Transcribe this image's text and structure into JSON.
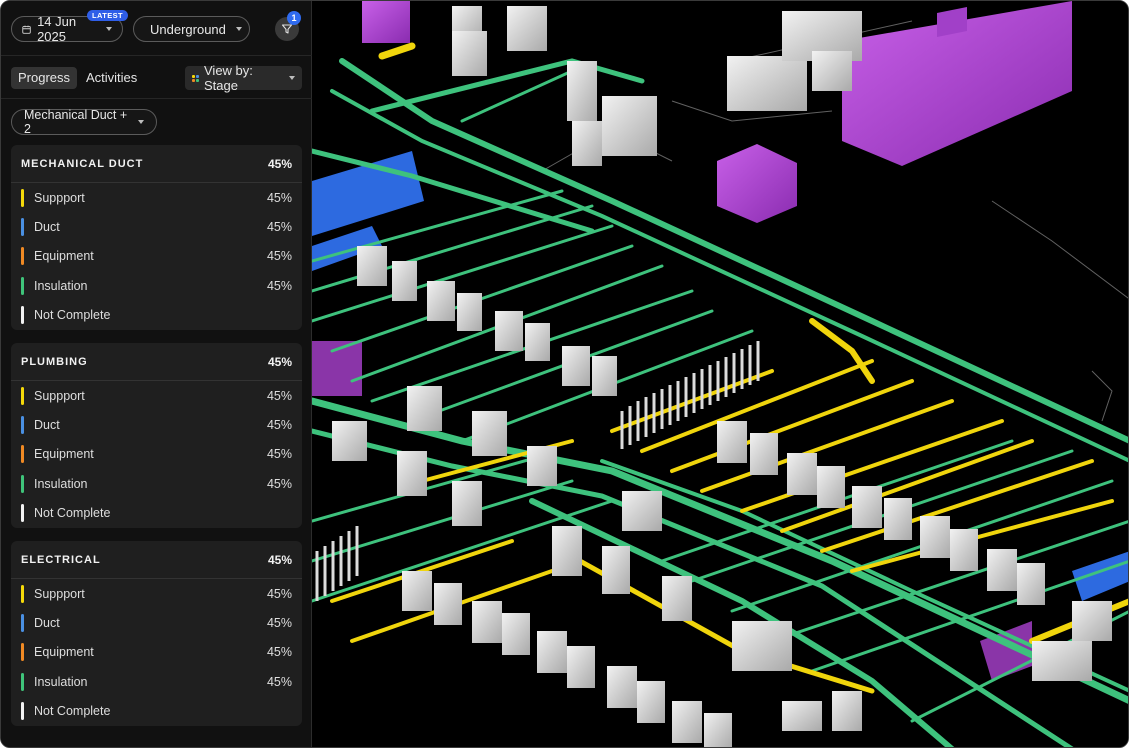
{
  "header": {
    "date_label": "14 Jun 2025",
    "latest_badge": "LATEST",
    "layer_label": "Underground",
    "filter_count": "1"
  },
  "tabs": [
    {
      "label": "Progress",
      "active": true
    },
    {
      "label": "Activities",
      "active": false
    }
  ],
  "view_by": {
    "label": "View by: Stage"
  },
  "trade_filter": {
    "label": "Mechanical Duct + 2"
  },
  "colors": {
    "support": "#f5d90a",
    "duct": "#4a90e2",
    "equipment": "#f08a24",
    "insulation": "#3fc47a",
    "not_complete": "#f2f2f2"
  },
  "sections": [
    {
      "title": "MECHANICAL DUCT",
      "percent": "45%",
      "rows": [
        {
          "label": "Suppport",
          "percent": "45%"
        },
        {
          "label": "Duct",
          "percent": "45%"
        },
        {
          "label": "Equipment",
          "percent": "45%"
        },
        {
          "label": "Insulation",
          "percent": "45%"
        },
        {
          "label": "Not Complete",
          "percent": ""
        }
      ]
    },
    {
      "title": "PLUMBING",
      "percent": "45%",
      "rows": [
        {
          "label": "Suppport",
          "percent": "45%"
        },
        {
          "label": "Duct",
          "percent": "45%"
        },
        {
          "label": "Equipment",
          "percent": "45%"
        },
        {
          "label": "Insulation",
          "percent": "45%"
        },
        {
          "label": "Not Complete",
          "percent": ""
        }
      ]
    },
    {
      "title": "ELECTRICAL",
      "percent": "45%",
      "rows": [
        {
          "label": "Suppport",
          "percent": "45%"
        },
        {
          "label": "Duct",
          "percent": "45%"
        },
        {
          "label": "Equipment",
          "percent": "45%"
        },
        {
          "label": "Insulation",
          "percent": "45%"
        },
        {
          "label": "Not Complete",
          "percent": ""
        }
      ]
    }
  ]
}
